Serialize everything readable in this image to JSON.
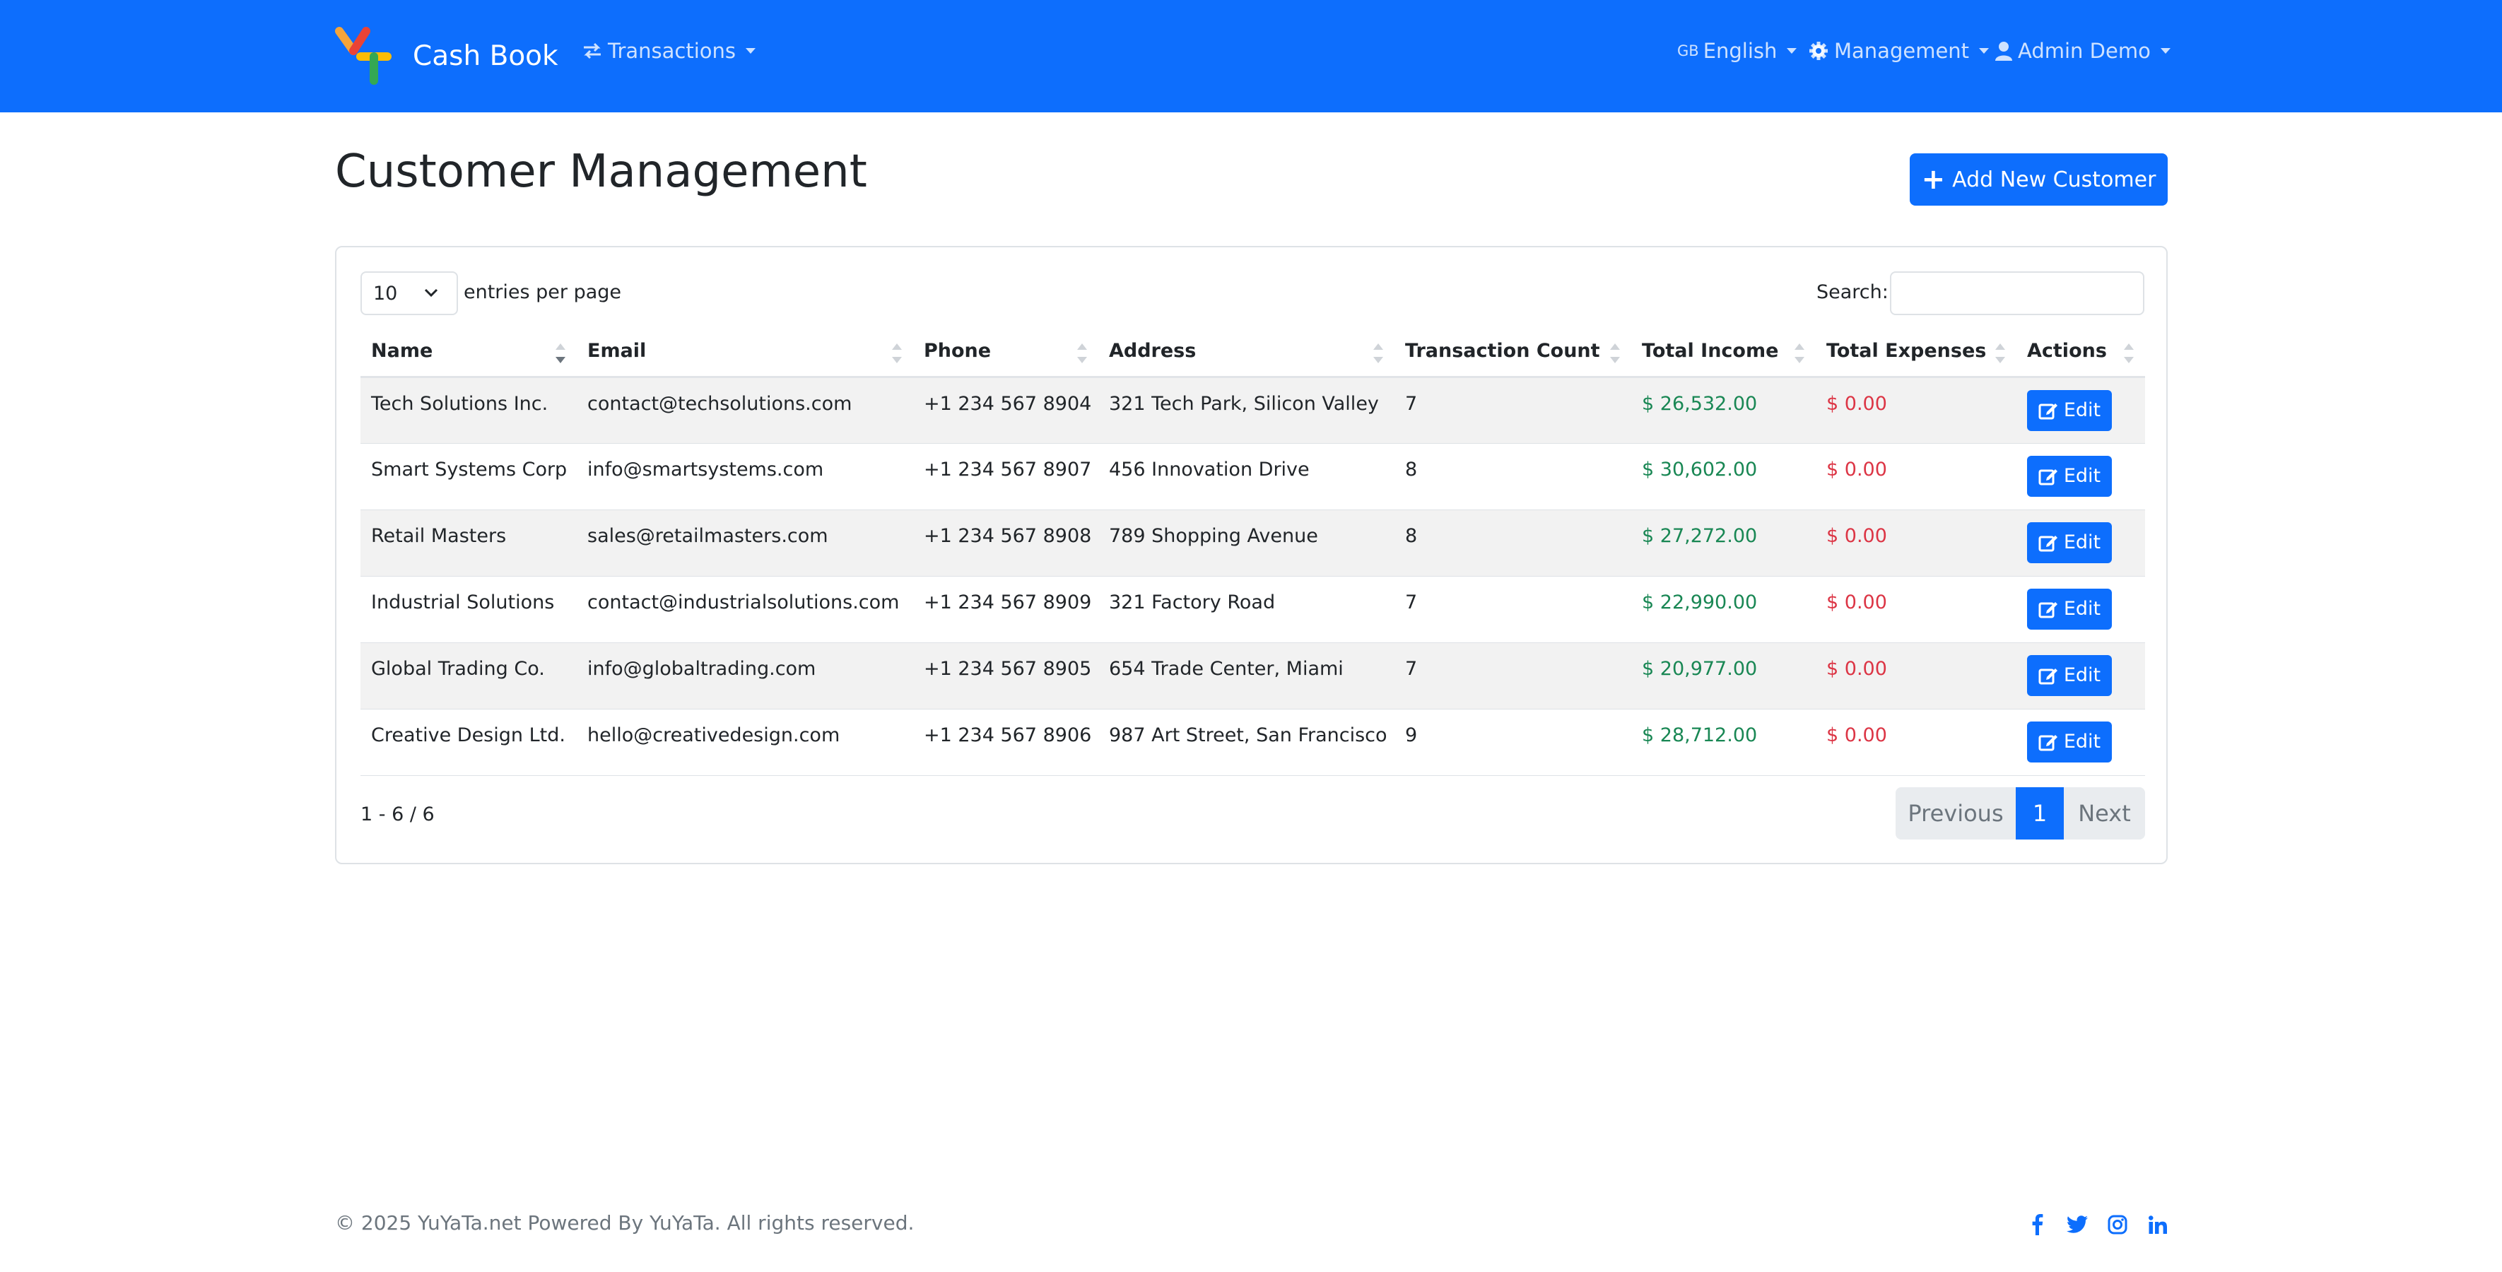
{
  "navbar": {
    "brand_title": "Cash Book",
    "transactions_label": "Transactions",
    "language_flag": "GB",
    "language_label": "English",
    "management_label": "Management",
    "user_label": "Admin Demo",
    "logo_colors": [
      "#f5a43a",
      "#ea4335",
      "#fbbc05",
      "#34a853"
    ]
  },
  "header": {
    "title": "Customer Management",
    "add_button_label": "Add New Customer"
  },
  "table_controls": {
    "entries_value": "10",
    "entries_label": "entries per page",
    "search_label": "Search:",
    "search_value": ""
  },
  "columns": [
    "Name",
    "Email",
    "Phone",
    "Address",
    "Transaction Count",
    "Total Income",
    "Total Expenses",
    "Actions"
  ],
  "rows": [
    {
      "name": "Tech Solutions Inc.",
      "email": "contact@techsolutions.com",
      "phone": "+1 234 567 8904",
      "address": "321 Tech Park, Silicon Valley",
      "count": "7",
      "income": "$ 26,532.00",
      "expenses": "$ 0.00",
      "action": "Edit"
    },
    {
      "name": "Smart Systems Corp",
      "email": "info@smartsystems.com",
      "phone": "+1 234 567 8907",
      "address": "456 Innovation Drive",
      "count": "8",
      "income": "$ 30,602.00",
      "expenses": "$ 0.00",
      "action": "Edit"
    },
    {
      "name": "Retail Masters",
      "email": "sales@retailmasters.com",
      "phone": "+1 234 567 8908",
      "address": "789 Shopping Avenue",
      "count": "8",
      "income": "$ 27,272.00",
      "expenses": "$ 0.00",
      "action": "Edit"
    },
    {
      "name": "Industrial Solutions",
      "email": "contact@industrialsolutions.com",
      "phone": "+1 234 567 8909",
      "address": "321 Factory Road",
      "count": "7",
      "income": "$ 22,990.00",
      "expenses": "$ 0.00",
      "action": "Edit"
    },
    {
      "name": "Global Trading Co.",
      "email": "info@globaltrading.com",
      "phone": "+1 234 567 8905",
      "address": "654 Trade Center, Miami",
      "count": "7",
      "income": "$ 20,977.00",
      "expenses": "$ 0.00",
      "action": "Edit"
    },
    {
      "name": "Creative Design Ltd.",
      "email": "hello@creativedesign.com",
      "phone": "+1 234 567 8906",
      "address": "987 Art Street, San Francisco",
      "count": "9",
      "income": "$ 28,712.00",
      "expenses": "$ 0.00",
      "action": "Edit"
    }
  ],
  "pagination": {
    "info": "1 - 6 / 6",
    "previous_label": "Previous",
    "current_page": "1",
    "next_label": "Next"
  },
  "footer": {
    "copyright": "© 2025 YuYaTa.net Powered By YuYaTa. All rights reserved.",
    "social_icons": [
      "facebook-icon",
      "twitter-icon",
      "instagram-icon",
      "linkedin-icon"
    ]
  },
  "colors": {
    "primary": "#0d6efd",
    "income": "#198754",
    "expense": "#dc3545"
  }
}
